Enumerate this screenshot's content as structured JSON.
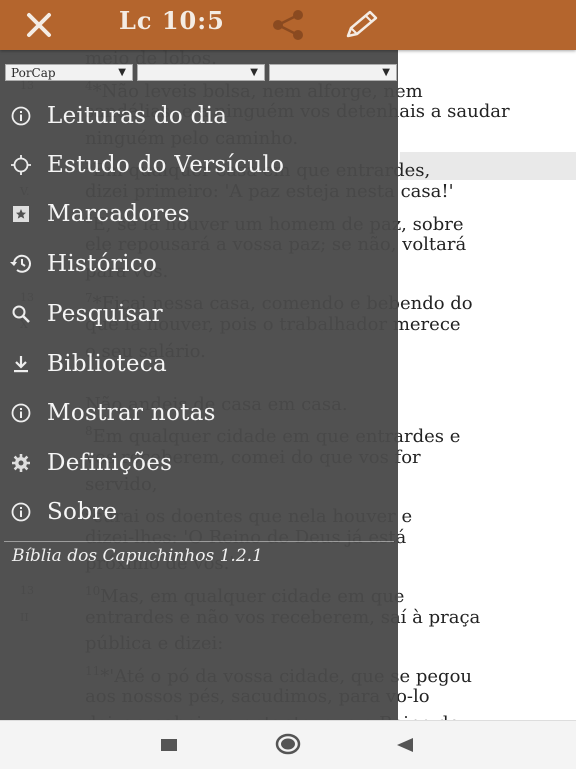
{
  "header": {
    "title": "Lc 10:5",
    "close_icon": "close-icon",
    "share_icon": "share-icon",
    "edit_icon": "pencil-icon",
    "background": "#b4652d"
  },
  "selectors": [
    {
      "value": "PorCap"
    },
    {
      "value": ""
    },
    {
      "value": ""
    }
  ],
  "menu": [
    {
      "label": "Leituras do dia",
      "icon": "info-icon"
    },
    {
      "label": "Estudo do Versículo",
      "icon": "target-icon"
    },
    {
      "label": "Marcadores",
      "icon": "bookmark-icon"
    },
    {
      "label": "Histórico",
      "icon": "history-icon"
    },
    {
      "label": "Pesquisar",
      "icon": "search-icon"
    },
    {
      "label": "Biblioteca",
      "icon": "download-icon"
    },
    {
      "label": "Mostrar notas",
      "icon": "info-icon"
    },
    {
      "label": "Definições",
      "icon": "gear-icon"
    },
    {
      "label": "Sobre",
      "icon": "info-icon"
    }
  ],
  "version": "Bíblia dos Capuchinhos 1.2.1",
  "bible_text": [
    {
      "vnum": "",
      "sup": "",
      "text": "meio de lobos."
    },
    {
      "vnum": "13",
      "sup": "4",
      "text": "*Não leveis bolsa, nem alforge, nem"
    },
    {
      "vnum": "",
      "sup": "",
      "text": "sandálias, e a ninguém vos detenhais a saudar"
    },
    {
      "vnum": "",
      "sup": "",
      "text": "ninguém pelo caminho."
    },
    {
      "vnum": "",
      "sup": "5",
      "text": "Em qualquer casa em que entrardes,"
    },
    {
      "vnum": "V.",
      "sup": "",
      "text": "dizei primeiro: 'A paz esteja nesta casa!'"
    },
    {
      "vnum": "",
      "sup": "6",
      "text": "E, se lá houver um homem de paz, sobre"
    },
    {
      "vnum": "",
      "sup": "",
      "text": "ele repousará a vossa paz; se não, voltará"
    },
    {
      "vnum": "",
      "sup": "",
      "text": "para vós."
    },
    {
      "vnum": "13",
      "sup": "7",
      "text": "*Ficai nessa casa, comendo e bebendo do"
    },
    {
      "vnum": "X",
      "sup": "",
      "text": "que lá houver, pois o trabalhador merece"
    },
    {
      "vnum": "",
      "sup": "",
      "text": "o seu salário."
    },
    {
      "vnum": "",
      "sup": "",
      "text": ""
    },
    {
      "vnum": "",
      "sup": "",
      "text": "Não andeis de casa em casa."
    },
    {
      "vnum": "",
      "sup": "8",
      "text": "Em qualquer cidade em que entrardes e"
    },
    {
      "vnum": "",
      "sup": "",
      "text": "vos receberem, comei do que vos for"
    },
    {
      "vnum": "",
      "sup": "",
      "text": "servido,"
    },
    {
      "vnum": "",
      "sup": "9",
      "text": "curai os doentes que nela houver e"
    },
    {
      "vnum": "",
      "sup": "",
      "text": "dizei-lhes: 'O Reino de Deus já está"
    },
    {
      "vnum": "",
      "sup": "",
      "text": "próximo de vós.'"
    },
    {
      "vnum": "13",
      "sup": "10",
      "text": "Mas, em qualquer cidade em que"
    },
    {
      "vnum": "II",
      "sup": "",
      "text": "entrardes e não vos receberem, saí à praça"
    },
    {
      "vnum": "",
      "sup": "",
      "text": "pública e dizei:"
    },
    {
      "vnum": "",
      "sup": "11",
      "text": "*'Até o pó da vossa cidade, que se pegou"
    },
    {
      "vnum": "",
      "sup": "",
      "text": "aos nossos pés, sacudimos, para vo-lo"
    },
    {
      "vnum": "",
      "sup": "",
      "text": "deixar; sabei, no entanto, que o Reino de"
    }
  ],
  "navbar": {
    "back_icon": "back-triangle-icon",
    "home_icon": "home-circle-icon",
    "recents_icon": "recents-square-icon"
  }
}
